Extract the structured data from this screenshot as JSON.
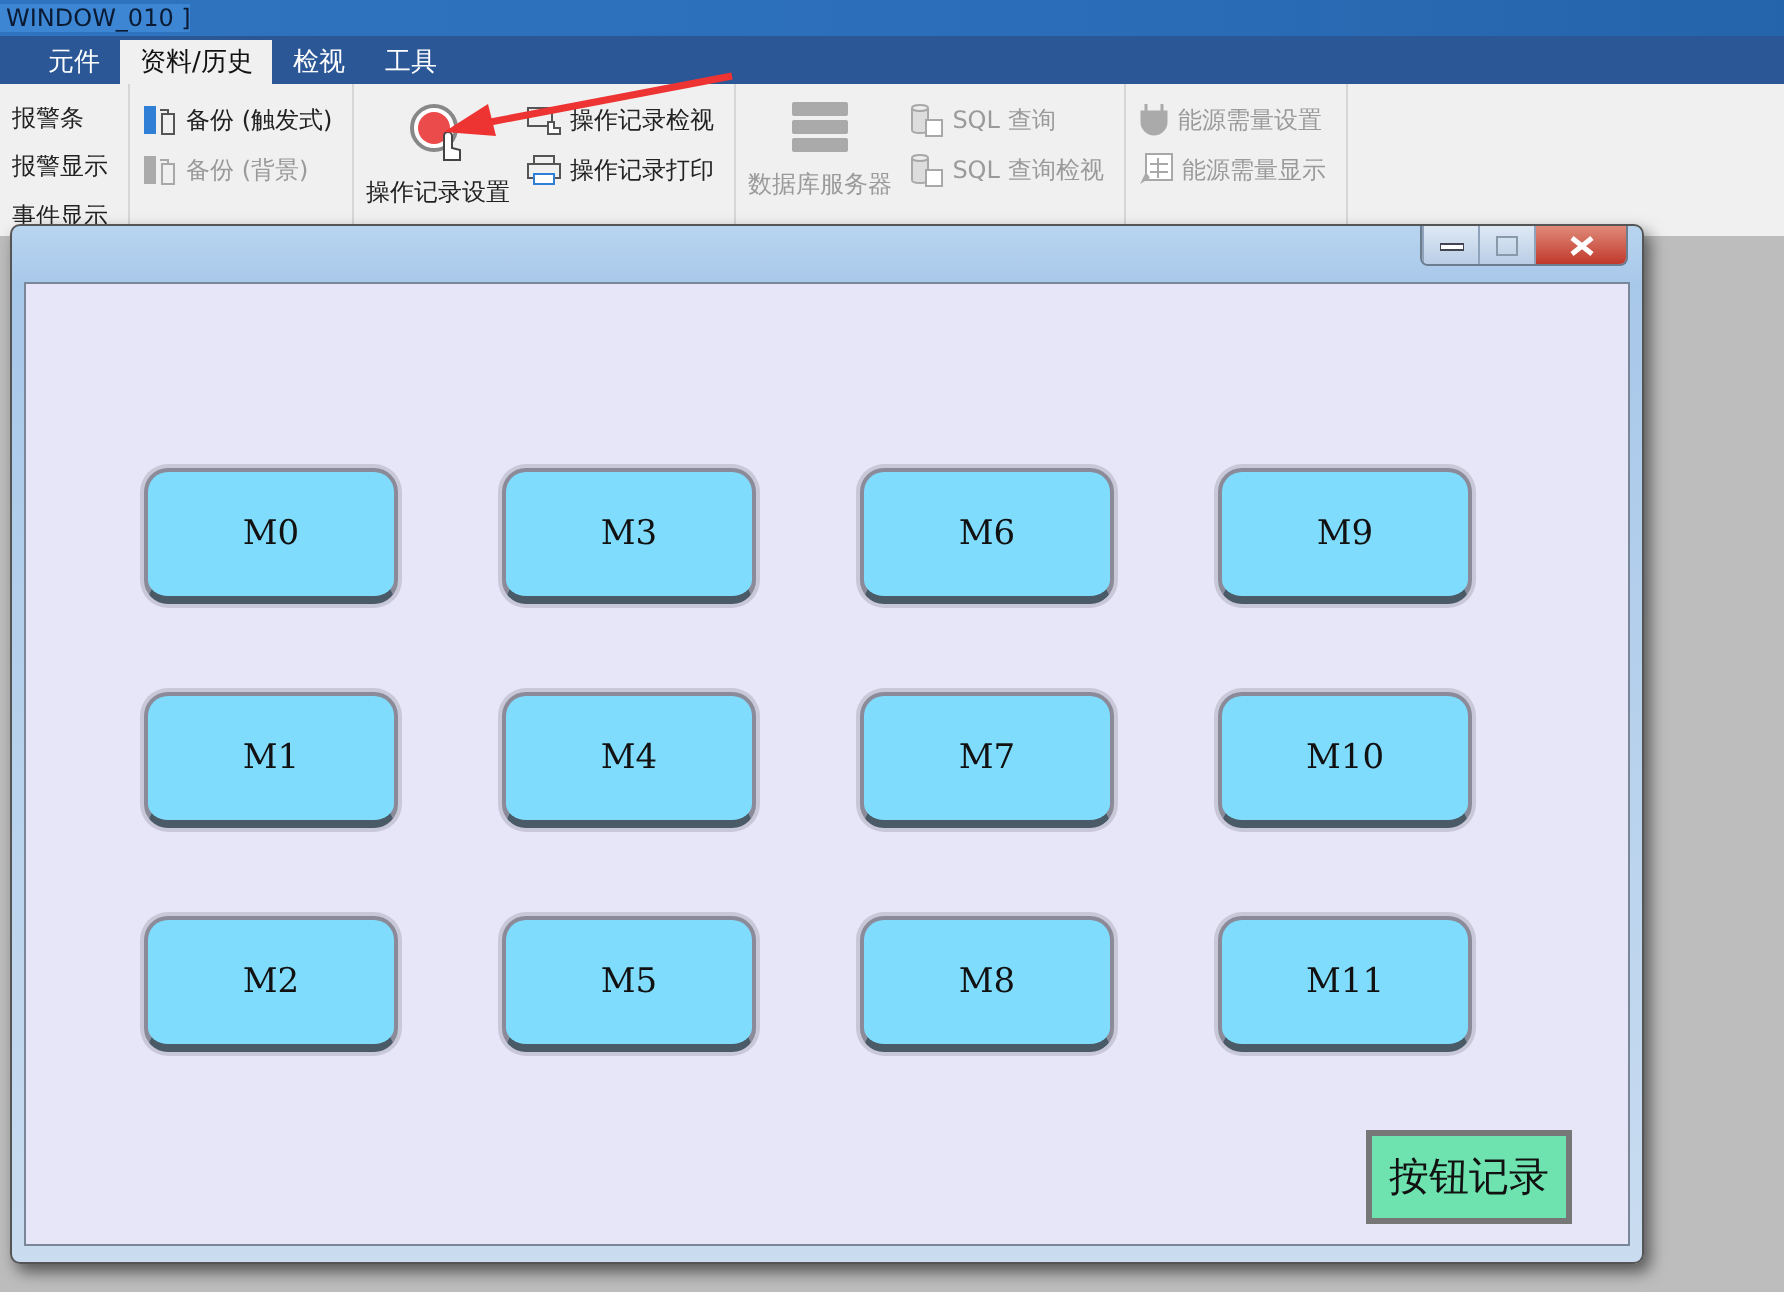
{
  "app_title": "WINDOW_010 ]",
  "tabs": [
    {
      "label": "元件",
      "selected": false
    },
    {
      "label": "资料/历史",
      "selected": true
    },
    {
      "label": "检视",
      "selected": false
    },
    {
      "label": "工具",
      "selected": false
    }
  ],
  "ribbon_groups": [
    {
      "items": [
        {
          "kind": "small",
          "label": "报警条",
          "disabled": false
        },
        {
          "kind": "small",
          "label": "报警显示",
          "disabled": false
        },
        {
          "kind": "small",
          "label": "事件显示",
          "disabled": false
        }
      ]
    },
    {
      "items": [
        {
          "kind": "small",
          "label": "备份 (触发式)",
          "disabled": false
        },
        {
          "kind": "small",
          "label": "备份 (背景)",
          "disabled": true
        }
      ]
    },
    {
      "items": [
        {
          "kind": "large",
          "label": "操作记录设置",
          "disabled": false
        },
        {
          "kind": "small",
          "label": "操作记录检视",
          "disabled": false
        },
        {
          "kind": "small",
          "label": "操作记录打印",
          "disabled": false
        }
      ]
    },
    {
      "items": [
        {
          "kind": "large",
          "label": "数据库服务器",
          "disabled": true
        },
        {
          "kind": "small",
          "label": "SQL 查询",
          "disabled": true
        },
        {
          "kind": "small",
          "label": "SQL 查询检视",
          "disabled": true
        }
      ]
    },
    {
      "items": [
        {
          "kind": "small",
          "label": "能源需量设置",
          "disabled": true
        },
        {
          "kind": "small",
          "label": "能源需量显示",
          "disabled": true
        }
      ]
    }
  ],
  "popup": {
    "buttons": [
      [
        "M0",
        "M3",
        "M6",
        "M9"
      ],
      [
        "M1",
        "M4",
        "M7",
        "M10"
      ],
      [
        "M2",
        "M5",
        "M8",
        "M11"
      ]
    ],
    "record_button": "按钮记录"
  }
}
